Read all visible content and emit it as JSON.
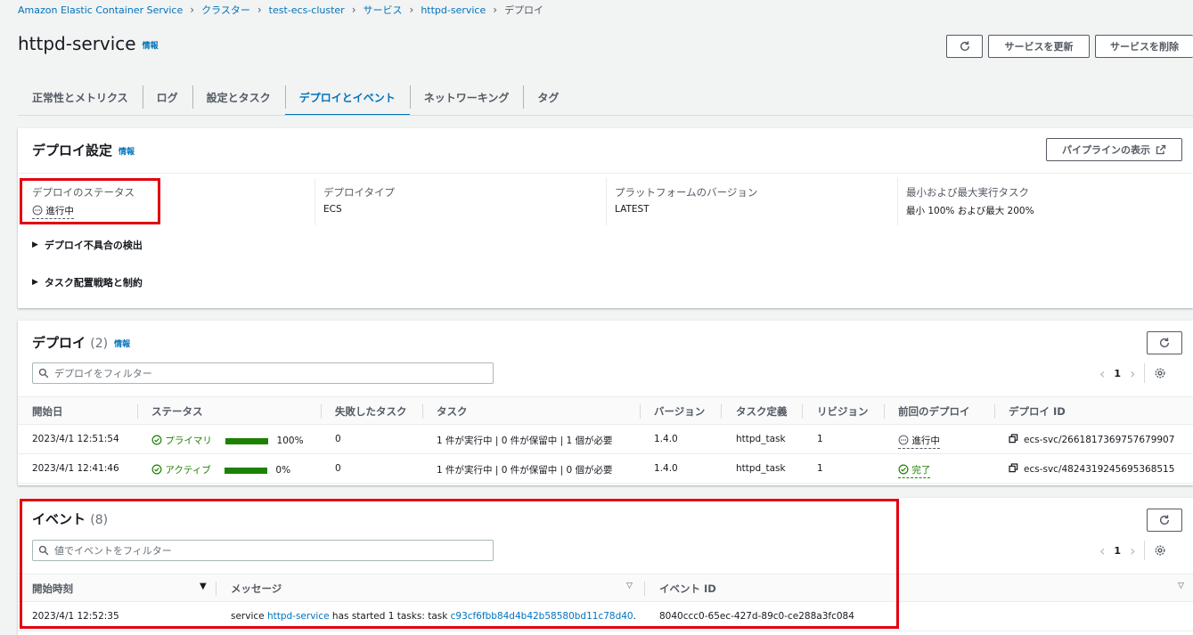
{
  "breadcrumb": [
    "Amazon Elastic Container Service",
    "クラスター",
    "test-ecs-cluster",
    "サービス",
    "httpd-service",
    "デプロイ"
  ],
  "title": "httpd-service",
  "info": "情報",
  "buttons": {
    "refresh_icon": "refresh-icon",
    "update": "サービスを更新",
    "delete": "サービスを削除"
  },
  "tabs": [
    "正常性とメトリクス",
    "ログ",
    "設定とタスク",
    "デプロイとイベント",
    "ネットワーキング",
    "タグ"
  ],
  "active_tab": "デプロイとイベント",
  "deploy_settings": {
    "title": "デプロイ設定",
    "pipeline_button": "パイプラインの表示",
    "fields": [
      {
        "label": "デプロイのステータス",
        "value": "進行中"
      },
      {
        "label": "デプロイタイプ",
        "value": "ECS"
      },
      {
        "label": "プラットフォームのバージョン",
        "value": "LATEST"
      },
      {
        "label": "最小および最大実行タスク",
        "value": "最小 100% および最大 200%"
      }
    ],
    "expand_1": "デプロイ不具合の検出",
    "expand_2": "タスク配置戦略と制約"
  },
  "deployments": {
    "title": "デプロイ",
    "count": "(2)",
    "filter_placeholder": "デプロイをフィルター",
    "page": "1",
    "columns": [
      "開始日",
      "ステータス",
      "失敗したタスク",
      "タスク",
      "バージョン",
      "タスク定義",
      "リビジョン",
      "前回のデプロイ",
      "デプロイ ID"
    ],
    "rows": [
      {
        "start": "2023/4/1 12:51:54",
        "status": "プライマリ",
        "progress": 100,
        "progress_label": "100%",
        "failed": "0",
        "tasks": "1 件が実行中 | 0 件が保留中 | 1 個が必要",
        "version": "1.4.0",
        "taskdef": "httpd_task",
        "revision": "1",
        "prev": "進行中",
        "id": "ecs-svc/2661817369757679907"
      },
      {
        "start": "2023/4/1 12:41:46",
        "status": "アクティブ",
        "progress": 0,
        "progress_label": "0%",
        "failed": "0",
        "tasks": "1 件が実行中 | 0 件が保留中 | 0 個が必要",
        "version": "1.4.0",
        "taskdef": "httpd_task",
        "revision": "1",
        "prev": "完了",
        "id": "ecs-svc/4824319245695368515"
      }
    ]
  },
  "events": {
    "title": "イベント",
    "count": "(8)",
    "filter_placeholder": "値でイベントをフィルター",
    "page": "1",
    "columns": [
      "開始時刻",
      "メッセージ",
      "イベント ID"
    ],
    "rows": [
      {
        "time": "2023/4/1 12:52:35",
        "msg_prefix": "service ",
        "msg_service": "httpd-service",
        "msg_mid": " has started 1 tasks: task ",
        "msg_task": "c93cf6fbb84d4b42b58580bd11c78d40",
        "msg_suffix": ".",
        "event_id": "8040ccc0-65ec-427d-89c0-ce288a3fc084"
      }
    ]
  },
  "colors": {
    "link": "#0073bb",
    "success": "#1d8102",
    "annotation": "#e2000f"
  }
}
